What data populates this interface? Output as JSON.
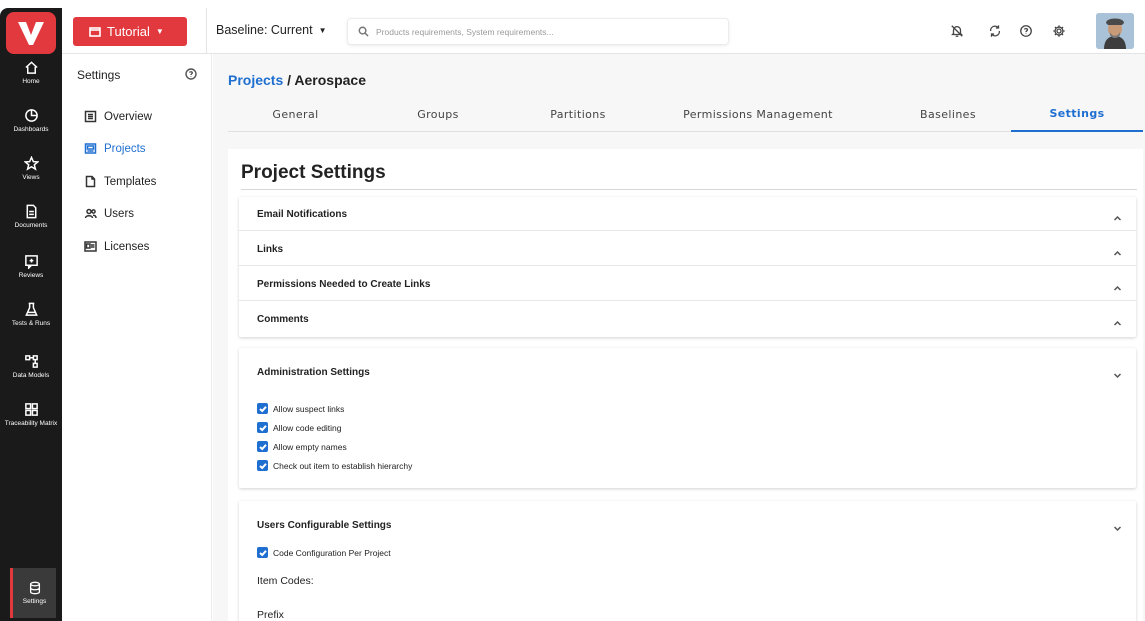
{
  "rail": {
    "items": [
      {
        "label": "Home",
        "icon": "home-icon"
      },
      {
        "label": "Dashboards",
        "icon": "dashboard-icon"
      },
      {
        "label": "Views",
        "icon": "star-icon"
      },
      {
        "label": "Documents",
        "icon": "document-icon"
      },
      {
        "label": "Reviews",
        "icon": "review-icon"
      },
      {
        "label": "Tests & Runs",
        "icon": "flask-icon"
      },
      {
        "label": "Data Models",
        "icon": "data-model-icon"
      },
      {
        "label": "Traceability Matrix",
        "icon": "matrix-icon"
      }
    ],
    "settings_label": "Settings"
  },
  "topbar": {
    "tutorial_label": "Tutorial",
    "baseline_label": "Baseline: Current",
    "search_placeholder": "Products requirements, System requirements..."
  },
  "sidebar": {
    "title": "Settings",
    "items": [
      {
        "label": "Overview",
        "icon": "overview-icon"
      },
      {
        "label": "Projects",
        "icon": "projects-icon"
      },
      {
        "label": "Templates",
        "icon": "template-icon"
      },
      {
        "label": "Users",
        "icon": "users-icon"
      },
      {
        "label": "Licenses",
        "icon": "license-icon"
      }
    ],
    "active": "Projects"
  },
  "breadcrumb": {
    "link": "Projects",
    "current": " / Aerospace"
  },
  "tabs": [
    {
      "label": "General"
    },
    {
      "label": "Groups"
    },
    {
      "label": "Partitions"
    },
    {
      "label": "Permissions Management"
    },
    {
      "label": "Baselines"
    },
    {
      "label": "Settings"
    }
  ],
  "active_tab": "Settings",
  "page": {
    "title": "Project Settings",
    "accordions": [
      {
        "title": "Email Notifications"
      },
      {
        "title": "Links"
      },
      {
        "title": "Permissions Needed to Create Links"
      },
      {
        "title": "Comments"
      }
    ],
    "admin": {
      "title": "Administration Settings",
      "options": [
        {
          "label": "Allow suspect links",
          "checked": true
        },
        {
          "label": "Allow code editing",
          "checked": true
        },
        {
          "label": "Allow empty names",
          "checked": true
        },
        {
          "label": "Check out item to establish hierarchy",
          "checked": true
        }
      ]
    },
    "users_config": {
      "title": "Users Configurable Settings",
      "option": {
        "label": "Code Configuration Per Project",
        "checked": true
      },
      "item_codes_label": "Item Codes:",
      "prefix_label": "Prefix"
    }
  },
  "colors": {
    "accent": "#1f6fd1",
    "brand": "#e2393e",
    "rail": "#1a1a1a"
  }
}
